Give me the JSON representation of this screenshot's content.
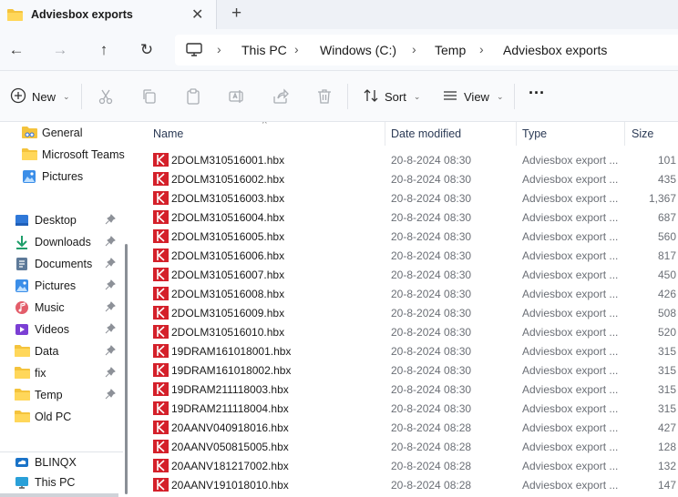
{
  "tab": {
    "title": "Adviesbox exports",
    "close_symbol": "✕",
    "new_tab_symbol": "+"
  },
  "nav": {
    "back": "←",
    "forward": "→",
    "up": "↑",
    "refresh": "↻"
  },
  "breadcrumb": [
    "This PC",
    "Windows  (C:)",
    "Temp",
    "Adviesbox exports"
  ],
  "toolbar": {
    "new_label": "New",
    "sort_label": "Sort",
    "view_label": "View",
    "more_label": "···"
  },
  "sidebar": {
    "top_items": [
      {
        "label": "General",
        "icon": "shared-folder-icon"
      },
      {
        "label": "Microsoft Teams",
        "icon": "folder-icon"
      },
      {
        "label": "Pictures",
        "icon": "pictures-icon"
      }
    ],
    "quick_access": [
      {
        "label": "Desktop",
        "icon": "desktop-icon",
        "pinned": true
      },
      {
        "label": "Downloads",
        "icon": "downloads-icon",
        "pinned": true
      },
      {
        "label": "Documents",
        "icon": "documents-icon",
        "pinned": true
      },
      {
        "label": "Pictures",
        "icon": "pictures-icon",
        "pinned": true
      },
      {
        "label": "Music",
        "icon": "music-icon",
        "pinned": true
      },
      {
        "label": "Videos",
        "icon": "videos-icon",
        "pinned": true
      },
      {
        "label": "Data",
        "icon": "folder-icon",
        "pinned": true
      },
      {
        "label": "fix",
        "icon": "folder-icon",
        "pinned": true
      },
      {
        "label": "Temp",
        "icon": "folder-icon",
        "pinned": true
      },
      {
        "label": "Old PC",
        "icon": "folder-icon",
        "pinned": false
      }
    ],
    "bottom_items": [
      {
        "label": "BLINQX",
        "icon": "onedrive-icon"
      },
      {
        "label": "This PC",
        "icon": "this-pc-icon"
      }
    ]
  },
  "columns": {
    "name": "Name",
    "date": "Date modified",
    "type": "Type",
    "size": "Size"
  },
  "colors": {
    "file_icon_red": "#d4202a",
    "folder_yellow": "#f4c33c",
    "accent_blue": "#2f6fdc"
  },
  "files": [
    {
      "name": "2DOLM310516001.hbx",
      "date": "20-8-2024 08:30",
      "type": "Adviesbox export ...",
      "size": "101"
    },
    {
      "name": "2DOLM310516002.hbx",
      "date": "20-8-2024 08:30",
      "type": "Adviesbox export ...",
      "size": "435"
    },
    {
      "name": "2DOLM310516003.hbx",
      "date": "20-8-2024 08:30",
      "type": "Adviesbox export ...",
      "size": "1,367"
    },
    {
      "name": "2DOLM310516004.hbx",
      "date": "20-8-2024 08:30",
      "type": "Adviesbox export ...",
      "size": "687"
    },
    {
      "name": "2DOLM310516005.hbx",
      "date": "20-8-2024 08:30",
      "type": "Adviesbox export ...",
      "size": "560"
    },
    {
      "name": "2DOLM310516006.hbx",
      "date": "20-8-2024 08:30",
      "type": "Adviesbox export ...",
      "size": "817"
    },
    {
      "name": "2DOLM310516007.hbx",
      "date": "20-8-2024 08:30",
      "type": "Adviesbox export ...",
      "size": "450"
    },
    {
      "name": "2DOLM310516008.hbx",
      "date": "20-8-2024 08:30",
      "type": "Adviesbox export ...",
      "size": "426"
    },
    {
      "name": "2DOLM310516009.hbx",
      "date": "20-8-2024 08:30",
      "type": "Adviesbox export ...",
      "size": "508"
    },
    {
      "name": "2DOLM310516010.hbx",
      "date": "20-8-2024 08:30",
      "type": "Adviesbox export ...",
      "size": "520"
    },
    {
      "name": "19DRAM161018001.hbx",
      "date": "20-8-2024 08:30",
      "type": "Adviesbox export ...",
      "size": "315"
    },
    {
      "name": "19DRAM161018002.hbx",
      "date": "20-8-2024 08:30",
      "type": "Adviesbox export ...",
      "size": "315"
    },
    {
      "name": "19DRAM211118003.hbx",
      "date": "20-8-2024 08:30",
      "type": "Adviesbox export ...",
      "size": "315"
    },
    {
      "name": "19DRAM211118004.hbx",
      "date": "20-8-2024 08:30",
      "type": "Adviesbox export ...",
      "size": "315"
    },
    {
      "name": "20AANV040918016.hbx",
      "date": "20-8-2024 08:28",
      "type": "Adviesbox export ...",
      "size": "427"
    },
    {
      "name": "20AANV050815005.hbx",
      "date": "20-8-2024 08:28",
      "type": "Adviesbox export ...",
      "size": "128"
    },
    {
      "name": "20AANV181217002.hbx",
      "date": "20-8-2024 08:28",
      "type": "Adviesbox export ...",
      "size": "132"
    },
    {
      "name": "20AANV191018010.hbx",
      "date": "20-8-2024 08:28",
      "type": "Adviesbox export ...",
      "size": "147"
    }
  ]
}
